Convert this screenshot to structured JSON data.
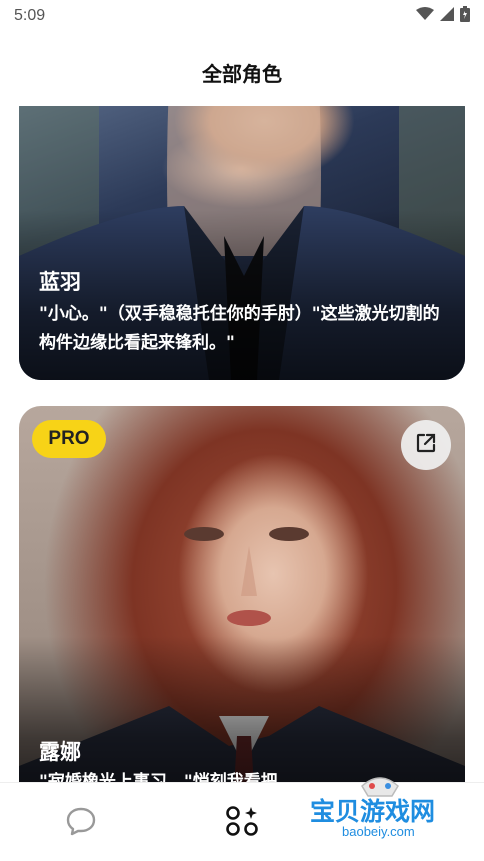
{
  "status_bar": {
    "time": "5:09"
  },
  "header": {
    "title": "全部角色"
  },
  "cards": [
    {
      "name": "蓝羽",
      "quote": "\"小心。\"（双手稳稳托住你的手肘）\"这些激光切割的构件边缘比看起来锋利。\""
    },
    {
      "name": "露娜",
      "quote": "\"寂婚橡光上事习…\"悄刻我看把…",
      "badge": "PRO"
    }
  ],
  "bottom_nav": {
    "items": [
      {
        "icon": "chat-bubble-icon"
      },
      {
        "icon": "apps-sparkle-icon"
      }
    ]
  },
  "watermark": {
    "title": "宝贝游戏网",
    "url": "baobeiy.com"
  },
  "colors": {
    "pro_badge": "#f7d317",
    "watermark": "#1f8de0"
  }
}
